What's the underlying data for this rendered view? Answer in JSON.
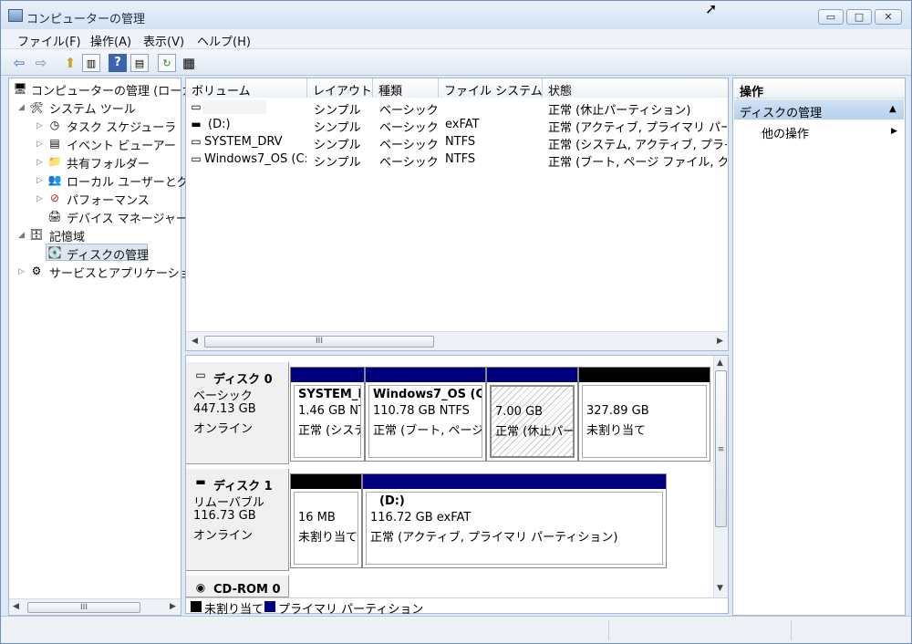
{
  "window": {
    "title": "コンピューターの管理",
    "buttons": {
      "minimize": "▭",
      "maximize": "□",
      "close": "✕"
    }
  },
  "menu": [
    "ファイル(F)",
    "操作(A)",
    "表示(V)",
    "ヘルプ(H)"
  ],
  "toolbar": {
    "icons": [
      "back-arrow-icon",
      "forward-arrow-icon",
      "folder-up-icon",
      "show-hide-tree-icon",
      "help-icon",
      "show-hide-action-icon",
      "refresh-icon",
      "properties-icon"
    ],
    "glyphs": {
      "back": "⇦",
      "forward": "⇨",
      "up": "⬆",
      "tree": "▥",
      "help": "?",
      "action": "▤",
      "refresh": "↻",
      "props": "▦"
    }
  },
  "tree": {
    "root": "コンピューターの管理 (ローカ",
    "system_tools": "システム ツール",
    "task_scheduler": "タスク スケジューラ",
    "event_viewer": "イベント ビューアー",
    "shared_folders": "共有フォルダー",
    "local_users": "ローカル ユーザーとグ",
    "performance": "パフォーマンス",
    "device_manager": "デバイス マネージャー",
    "storage": "記憶域",
    "disk_management": "ディスクの管理",
    "services": "サービスとアプリケーショ"
  },
  "volume_table": {
    "columns": [
      "ボリューム",
      "レイアウト",
      "種類",
      "ファイル システム",
      "状態"
    ],
    "rows": [
      {
        "volume": "",
        "layout": "シンプル",
        "type": "ベーシック",
        "fs": "",
        "status": "正常 (休止パーティション)"
      },
      {
        "volume": "(D:)",
        "layout": "シンプル",
        "type": "ベーシック",
        "fs": "exFAT",
        "status": "正常 (アクティブ, プライマリ パーテ"
      },
      {
        "volume": "SYSTEM_DRV",
        "layout": "シンプル",
        "type": "ベーシック",
        "fs": "NTFS",
        "status": "正常 (システム, アクティブ, プライマ"
      },
      {
        "volume": "Windows7_OS (C:)",
        "layout": "シンプル",
        "type": "ベーシック",
        "fs": "NTFS",
        "status": "正常 (ブート, ページ ファイル, クラ"
      }
    ]
  },
  "disks": [
    {
      "name": "ディスク 0",
      "kind": "ベーシック",
      "size": "447.13 GB",
      "state": "オンライン",
      "partitions": [
        {
          "name": "SYSTEM_D",
          "size": "1.46 GB NT",
          "status": "正常 (システ"
        },
        {
          "name": "Windows7_OS (C",
          "size": "110.78 GB NTFS",
          "status": "正常 (ブート, ページ"
        },
        {
          "name": "",
          "size": "7.00 GB",
          "status": "正常 (休止パーテ"
        },
        {
          "name": "",
          "size": "327.89 GB",
          "status": "未割り当て"
        }
      ]
    },
    {
      "name": "ディスク 1",
      "kind": "リムーバブル",
      "size": "116.73 GB",
      "state": "オンライン",
      "partitions": [
        {
          "name": "",
          "size": "16 MB",
          "status": "未割り当て"
        },
        {
          "name": "(D:)",
          "size": "116.72 GB exFAT",
          "status": "正常 (アクティブ, プライマリ パーティション)"
        }
      ]
    },
    {
      "name": "CD-ROM 0"
    }
  ],
  "legend": [
    "未割り当て",
    "プライマリ パーティション"
  ],
  "actions": {
    "title": "操作",
    "section": "ディスクの管理",
    "item": "他の操作",
    "arrow_up": "▲",
    "arrow_right": "▶"
  },
  "scroll": {
    "thumb_grip": "III",
    "vthumb_grip": "≡",
    "left": "◀",
    "right": "▶",
    "up": "▲",
    "down": "▼"
  },
  "colors": {
    "primary_partition": "#00007f",
    "unallocated": "#000000",
    "accent": "#c8daf0"
  }
}
